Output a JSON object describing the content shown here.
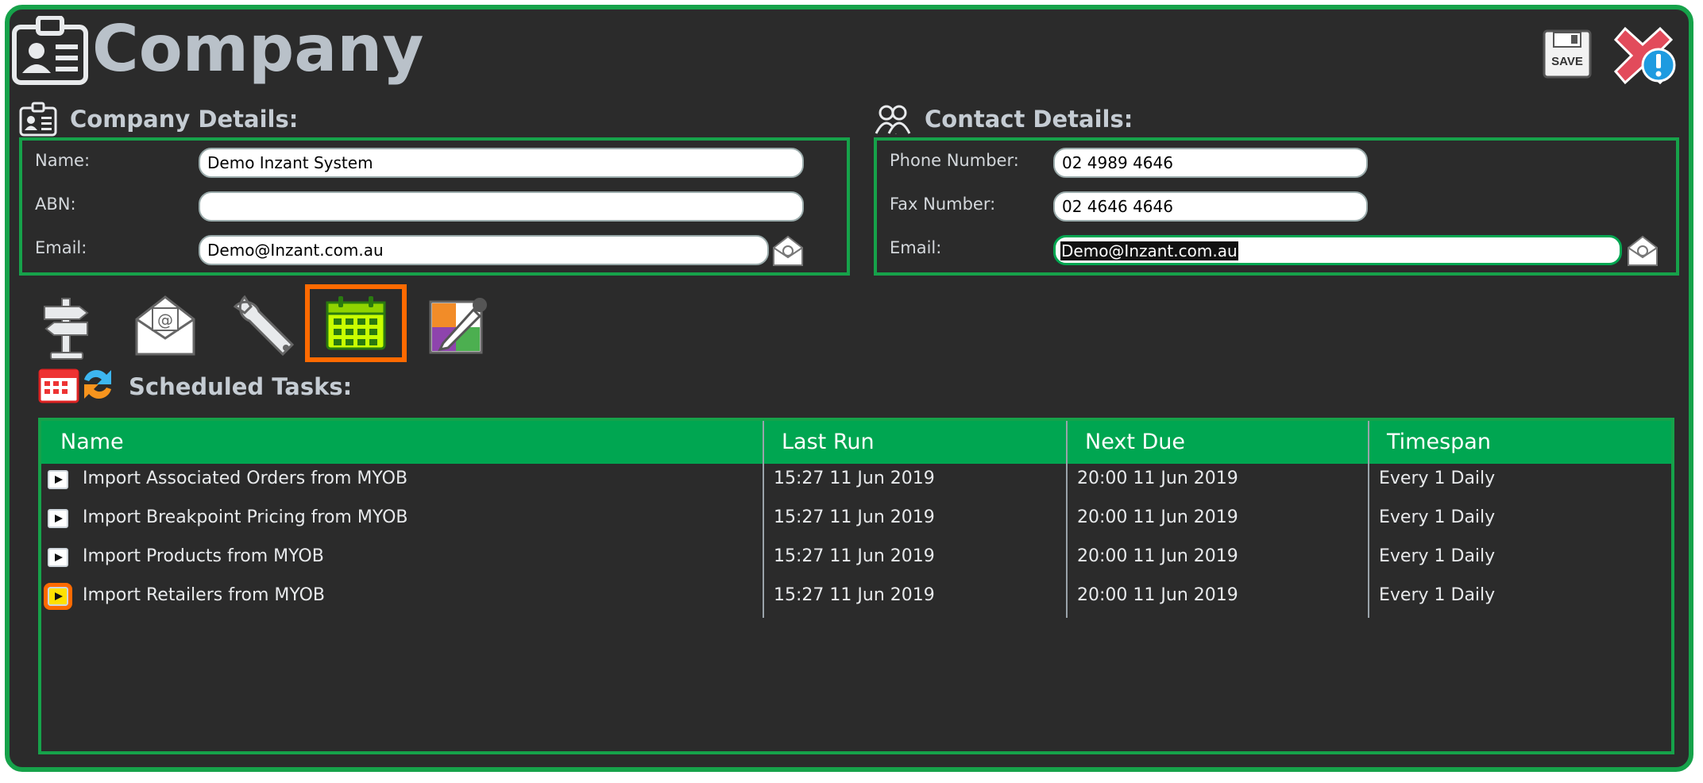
{
  "page": {
    "title": "Company"
  },
  "toolbar": {
    "save_label": "SAVE"
  },
  "company_details": {
    "heading": "Company Details:",
    "fields": {
      "name": {
        "label": "Name:",
        "value": "Demo Inzant System"
      },
      "abn": {
        "label": "ABN:",
        "value": ""
      },
      "email": {
        "label": "Email:",
        "value": "Demo@Inzant.com.au"
      }
    }
  },
  "contact_details": {
    "heading": "Contact Details:",
    "fields": {
      "phone": {
        "label": "Phone Number:",
        "value": "02 4989 4646"
      },
      "fax": {
        "label": "Fax Number:",
        "value": "02 4646 4646"
      },
      "email": {
        "label": "Email:",
        "value": "Demo@Inzant.com.au"
      }
    }
  },
  "tool_tabs": [
    {
      "icon": "signpost-icon",
      "active": false
    },
    {
      "icon": "email-envelope-icon",
      "active": false
    },
    {
      "icon": "wrench-icon",
      "active": false
    },
    {
      "icon": "calendar-icon",
      "active": true
    },
    {
      "icon": "color-picker-icon",
      "active": false
    }
  ],
  "scheduled_tasks": {
    "heading": "Scheduled Tasks:",
    "columns": [
      "Name",
      "Last Run",
      "Next Due",
      "Timespan"
    ],
    "rows": [
      {
        "name": "Import Associated Orders from MYOB",
        "last_run": "15:27 11 Jun 2019",
        "next_due": "20:00 11 Jun 2019",
        "timespan": "Every 1 Daily",
        "selected": false
      },
      {
        "name": "Import Breakpoint Pricing from MYOB",
        "last_run": "15:27 11 Jun 2019",
        "next_due": "20:00 11 Jun 2019",
        "timespan": "Every 1 Daily",
        "selected": false
      },
      {
        "name": "Import Products from MYOB",
        "last_run": "15:27 11 Jun 2019",
        "next_due": "20:00 11 Jun 2019",
        "timespan": "Every 1 Daily",
        "selected": false
      },
      {
        "name": "Import Retailers from MYOB",
        "last_run": "15:27 11 Jun 2019",
        "next_due": "20:00 11 Jun 2019",
        "timespan": "Every 1 Daily",
        "selected": true
      }
    ]
  },
  "colors": {
    "accent": "#00a651",
    "highlight": "#ff6a00",
    "background": "#2b2b2b"
  }
}
